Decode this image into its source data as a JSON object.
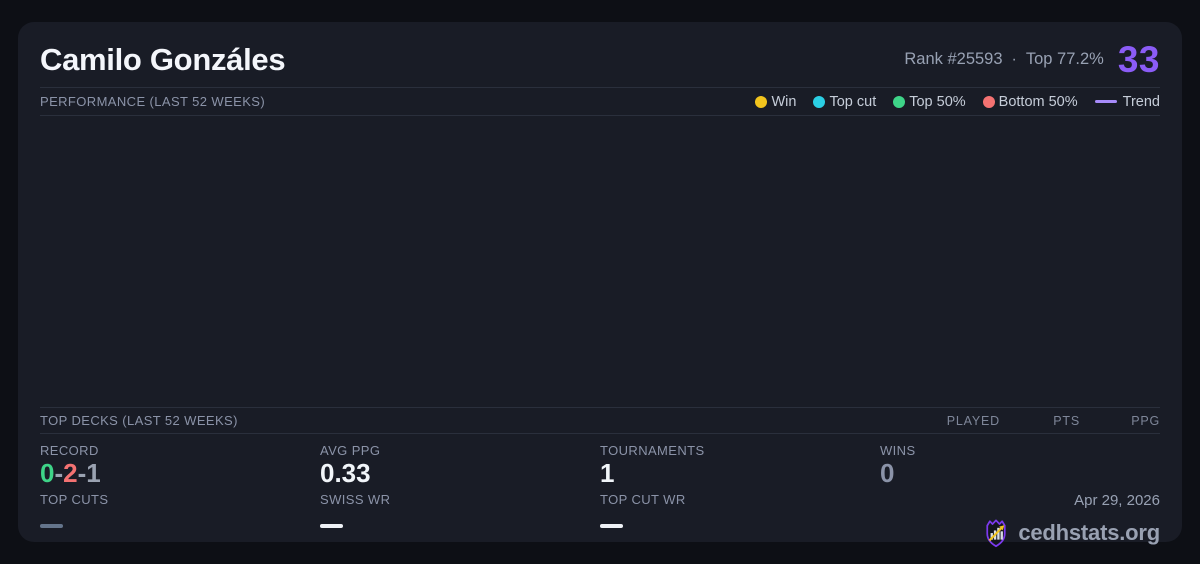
{
  "theme": {
    "background": "#0d0f15",
    "card": "#191c26",
    "divider": "#2a2f3c",
    "text_primary": "#f3f5f9",
    "text_muted": "#8b93a8"
  },
  "header": {
    "title": "Camilo Gonzáles",
    "rank": "Rank #25593",
    "dot": "·",
    "top_percent": "Top 77.2%",
    "score": "33",
    "score_color": "#8b5cf6"
  },
  "performance": {
    "label": "PERFORMANCE (LAST 52 WEEKS)",
    "legend": [
      {
        "label": "Win",
        "color": "#f2c41d",
        "marker": "dot"
      },
      {
        "label": "Top cut",
        "color": "#2bcfe4",
        "marker": "dot"
      },
      {
        "label": "Top 50%",
        "color": "#3ed488",
        "marker": "dot"
      },
      {
        "label": "Bottom 50%",
        "color": "#f47272",
        "marker": "dot"
      },
      {
        "label": "Trend",
        "color": "#a78bfa",
        "marker": "line"
      }
    ],
    "chart": {
      "type": "scatter",
      "points": []
    }
  },
  "top_decks": {
    "label": "TOP DECKS (LAST 52 WEEKS)",
    "columns": [
      "PLAYED",
      "PTS",
      "PPG"
    ],
    "rows": []
  },
  "stats": {
    "record": {
      "label": "RECORD",
      "wins": "0",
      "losses": "2",
      "draws": "1",
      "separator": "-",
      "wins_color": "#3ed488",
      "losses_color": "#f47272",
      "draws_color": "#9aa2b1"
    },
    "avg_ppg": {
      "label": "AVG PPG",
      "value": "0.33"
    },
    "tournaments": {
      "label": "TOURNAMENTS",
      "value": "1"
    },
    "wins": {
      "label": "WINS",
      "value": "0",
      "value_color": "#8b93a8"
    },
    "top_cuts": {
      "label": "TOP CUTS",
      "dash_color": "#64748b"
    },
    "swiss_wr": {
      "label": "SWISS WR",
      "dash_color": "#eef1f6"
    },
    "top_cut_wr": {
      "label": "TOP CUT WR",
      "dash_color": "#eef1f6"
    }
  },
  "footer": {
    "date": "Apr 29, 2026",
    "site": "cedhstats.org",
    "logo_colors": {
      "shield": "#7c3aed",
      "bars": "#d9dde3",
      "arrow": "#f2c41d"
    }
  }
}
